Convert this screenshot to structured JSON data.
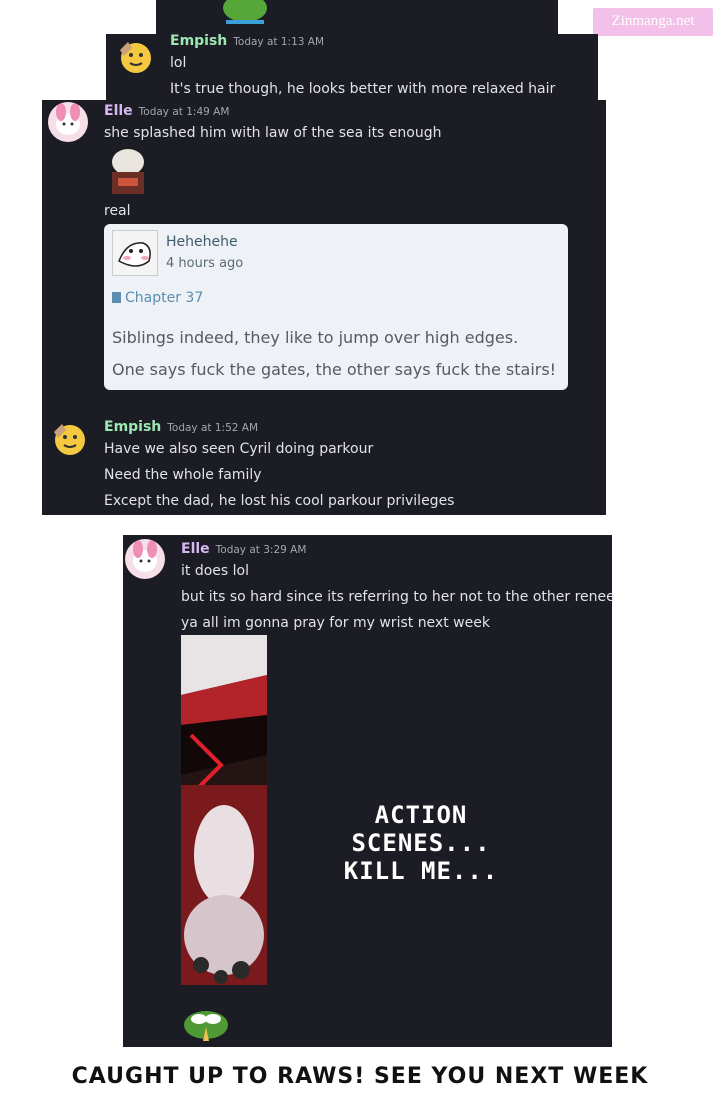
{
  "watermark": "Zinmanga.net",
  "panel1": {
    "author": "Empish",
    "timestamp": "Today at 1:13 AM",
    "lines": [
      "lol",
      "It's true though, he looks better with more relaxed hair"
    ]
  },
  "panel2": {
    "msg1": {
      "author": "Elle",
      "timestamp": "Today at 1:49 AM",
      "line1": "she splashed him with law of the sea its enough",
      "line2": "real"
    },
    "embed": {
      "author": "Hehehehe",
      "time": "4 hours ago",
      "link": "Chapter 37",
      "lines": [
        "Siblings indeed, they like to jump over high edges.",
        "One says fuck the gates, the other says fuck the stairs!"
      ]
    },
    "msg2": {
      "author": "Empish",
      "timestamp": "Today at 1:52 AM",
      "lines": [
        "Have we also seen Cyril doing parkour",
        "Need the whole family",
        "Except the dad, he lost his cool parkour privileges"
      ]
    }
  },
  "panel3": {
    "author": "Elle",
    "timestamp": "Today at 3:29 AM",
    "lines": [
      "it does lol",
      "but its so hard since its referring to her not to the other renee",
      "ya all im gonna pray for my wrist next week"
    ],
    "caption": [
      "ACTION SCENES...",
      "KILL ME..."
    ]
  },
  "footer": "CAUGHT UP TO RAWS! SEE YOU  NEXT WEEK",
  "colors": {
    "panel_bg": "#1c1d24",
    "empish_name": "#9ce8b3",
    "elle_name": "#d7b7f2",
    "link": "#3b8fd4",
    "embed_bg": "#eef1f5"
  },
  "icons": [
    "frog-emote",
    "emoji-face-avatar",
    "pink-bunny-avatar",
    "meme-emote",
    "file-icon",
    "manga-strip-image",
    "praying-frog-emote"
  ]
}
